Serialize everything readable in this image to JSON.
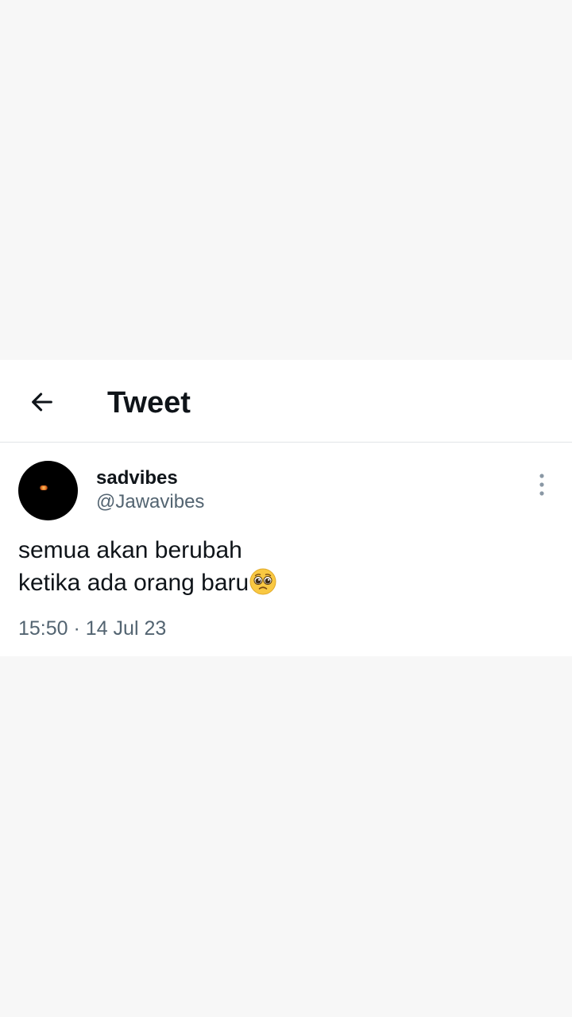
{
  "header": {
    "title": "Tweet",
    "back_icon": "arrow-left-icon"
  },
  "tweet": {
    "author": {
      "display_name": "sadvibes",
      "handle": "@Jawavibes"
    },
    "text_lines": [
      "semua akan berubah",
      "ketika ada orang baru"
    ],
    "emoji": "pleading-face-emoji",
    "time": "15:50",
    "separator": "·",
    "date": "14 Jul 23",
    "more_icon": "more-vertical-icon"
  },
  "colors": {
    "page_background": "#f7f7f7",
    "card_background": "#ffffff",
    "text_primary": "#0f1419",
    "text_secondary": "#536471",
    "divider": "#e1e4e7"
  }
}
